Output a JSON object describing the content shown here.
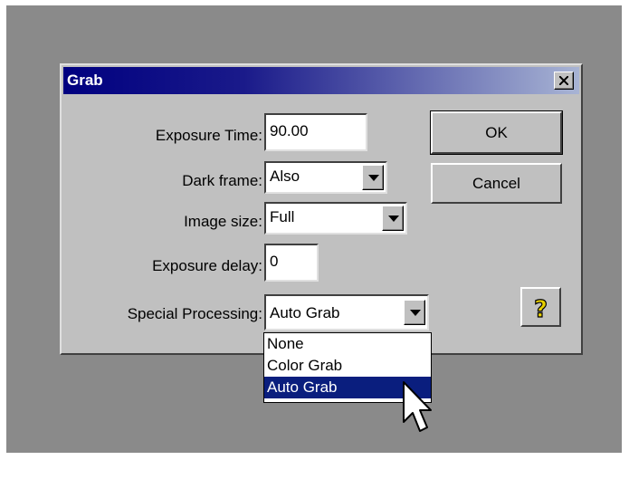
{
  "dialog": {
    "title": "Grab",
    "close_label": "×"
  },
  "fields": {
    "exposure_time": {
      "label": "Exposure Time:",
      "value": "90.00"
    },
    "dark_frame": {
      "label": "Dark frame:",
      "value": "Also"
    },
    "image_size": {
      "label": "Image size:",
      "value": "Full"
    },
    "exposure_delay": {
      "label": "Exposure delay:",
      "value": "0"
    },
    "special_processing": {
      "label": "Special Processing:",
      "value": "Auto Grab",
      "options": [
        "None",
        "Color Grab",
        "Auto Grab"
      ],
      "selected_index": 2
    }
  },
  "buttons": {
    "ok": "OK",
    "cancel": "Cancel",
    "help_icon": "question-mark-icon"
  },
  "colors": {
    "title_start": "#000080",
    "selection": "#0a1e7e",
    "dialog_face": "#c0c0c0",
    "desktop": "#8a8a8a"
  }
}
